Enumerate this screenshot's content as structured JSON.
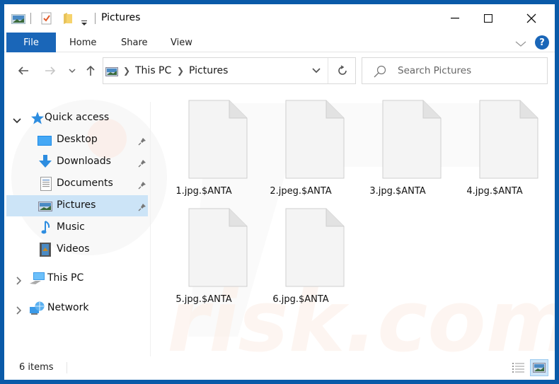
{
  "window": {
    "title": "Pictures",
    "controls": {
      "minimize": "—",
      "maximize": "☐",
      "close": "✕"
    }
  },
  "ribbon": {
    "tabs": [
      {
        "label": "File",
        "active": true
      },
      {
        "label": "Home"
      },
      {
        "label": "Share"
      },
      {
        "label": "View"
      }
    ],
    "help_label": "?"
  },
  "navigation": {
    "breadcrumb": [
      "This PC",
      "Pictures"
    ],
    "search_placeholder": "Search Pictures"
  },
  "sidebar": {
    "quick_access": {
      "label": "Quick access",
      "items": [
        {
          "label": "Desktop",
          "icon": "desktop-icon",
          "pinned": true
        },
        {
          "label": "Downloads",
          "icon": "downloads-icon",
          "pinned": true
        },
        {
          "label": "Documents",
          "icon": "documents-icon",
          "pinned": true
        },
        {
          "label": "Pictures",
          "icon": "pictures-icon",
          "pinned": true,
          "selected": true
        },
        {
          "label": "Music",
          "icon": "music-icon",
          "pinned": false
        },
        {
          "label": "Videos",
          "icon": "videos-icon",
          "pinned": false
        }
      ]
    },
    "this_pc": {
      "label": "This PC"
    },
    "network": {
      "label": "Network"
    }
  },
  "files": [
    {
      "name": "1.jpg.$ANTA"
    },
    {
      "name": "2.jpeg.$ANTA"
    },
    {
      "name": "3.jpg.$ANTA"
    },
    {
      "name": "4.jpg.$ANTA"
    },
    {
      "name": "5.jpg.$ANTA"
    },
    {
      "name": "6.jpg.$ANTA"
    }
  ],
  "status": {
    "item_count": "6 items"
  },
  "colors": {
    "accent": "#1a66b8",
    "selection": "#cce4f7",
    "frame": "#0a5aa8"
  }
}
